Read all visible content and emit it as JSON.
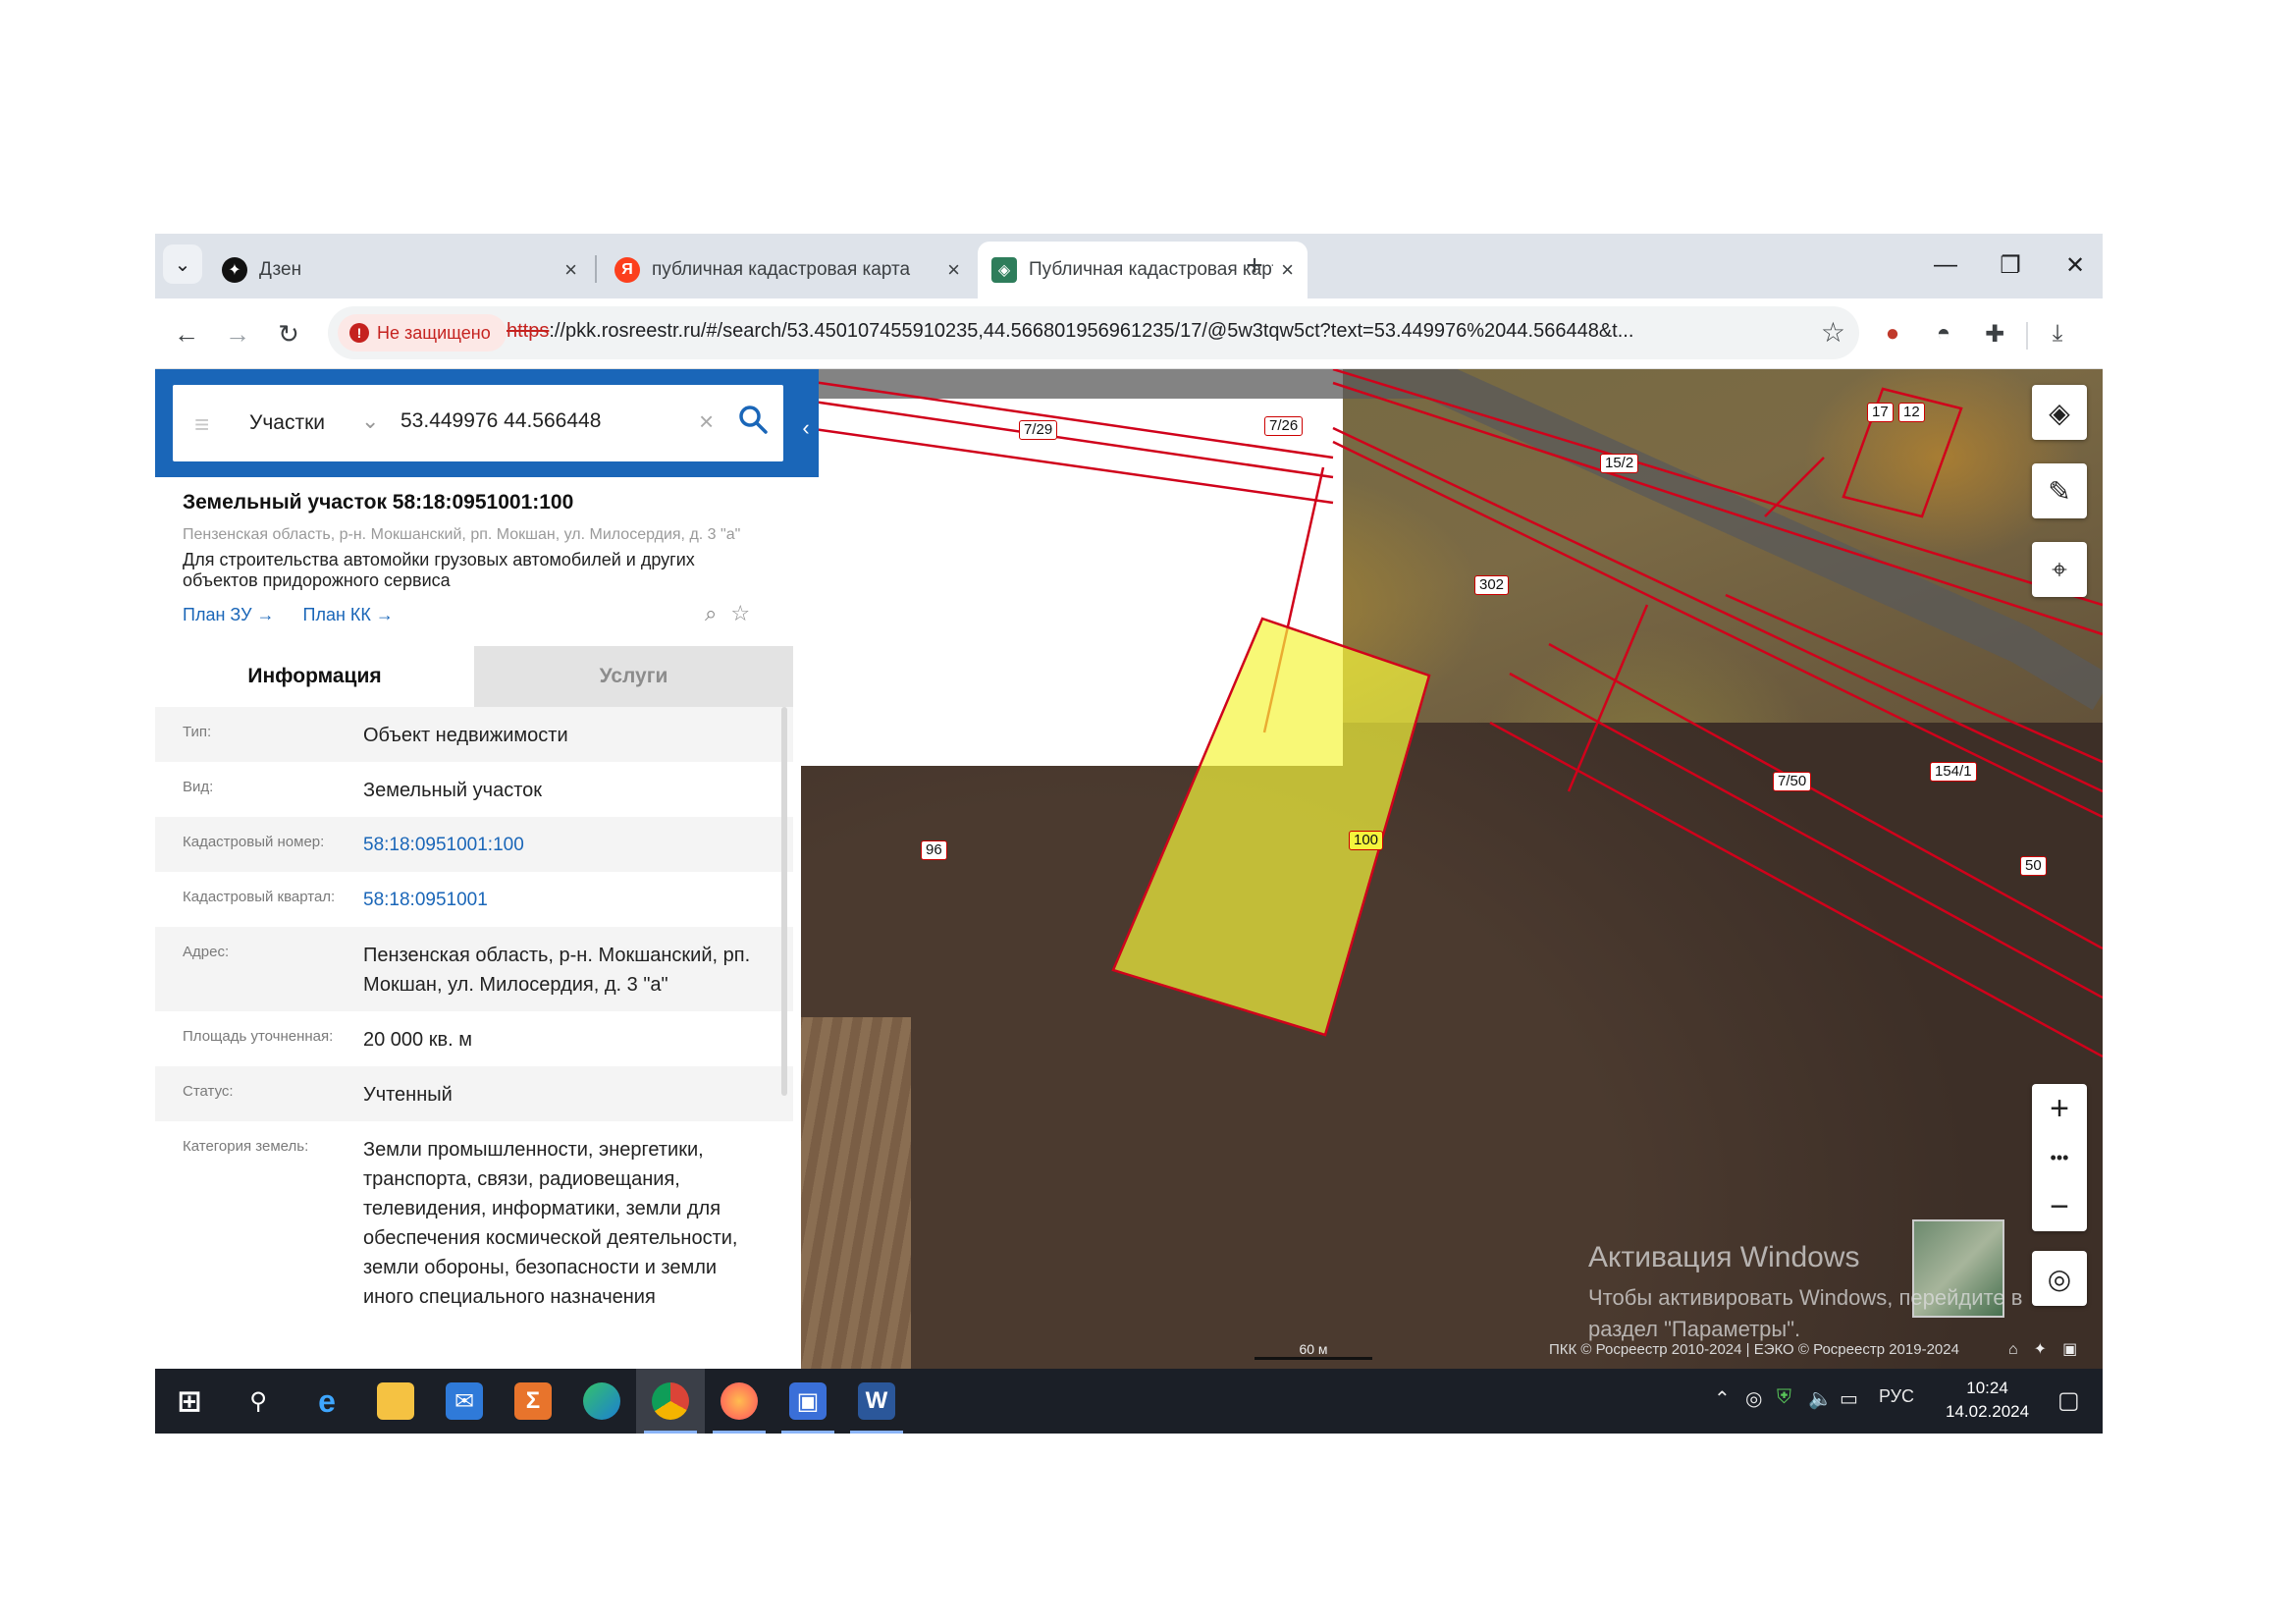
{
  "browser": {
    "tabs": [
      {
        "title": "Дзен",
        "icon": "dzen-icon",
        "active": false
      },
      {
        "title": "публичная кадастровая карта",
        "icon": "yandex-icon",
        "active": false
      },
      {
        "title": "Публичная кадастровая карта",
        "icon": "rosreestr-icon",
        "active": true
      }
    ],
    "new_tab_label": "+",
    "security_label": "Не защищено",
    "url_scheme": "https",
    "url_rest": "://pkk.rosreestr.ru/#/search/53.450107455910235,44.566801956961235/17/@5w3tqw5ct?text=53.449976%2044.566448&t..."
  },
  "search": {
    "category": "Участки",
    "query": "53.449976 44.566448"
  },
  "object": {
    "title": "Земельный участок 58:18:0951001:100",
    "address_short": "Пензенская область, р-н. Мокшанский, рп. Мокшан, ул. Милосердия, д. 3 \"а\"",
    "use": "Для строительства автомойки грузовых автомобилей и других объектов придорожного сервиса",
    "link_plan_zu": "План ЗУ →",
    "link_plan_kk": "План КК →"
  },
  "info_tabs": {
    "info": "Информация",
    "services": "Услуги"
  },
  "properties": [
    {
      "label": "Тип:",
      "value": "Объект недвижимости"
    },
    {
      "label": "Вид:",
      "value": "Земельный участок"
    },
    {
      "label": "Кадастровый номер:",
      "value": "58:18:0951001:100"
    },
    {
      "label": "Кадастровый квартал:",
      "value": "58:18:0951001"
    },
    {
      "label": "Адрес:",
      "value": "Пензенская область, р-н. Мокшанский, рп. Мокшан, ул. Милосердия, д. 3 \"а\""
    },
    {
      "label": "Площадь уточненная:",
      "value": "20 000 кв. м"
    },
    {
      "label": "Статус:",
      "value": "Учтенный"
    },
    {
      "label": "Категория земель:",
      "value": "Земли промышленности, энергетики, транспорта, связи, радиовещания, телевидения, информатики, земли для обеспечения космической деятельности, земли обороны, безопасности и земли иного специального назначения"
    }
  ],
  "map": {
    "parcel_labels": [
      "7/29",
      "7/26",
      "15/2",
      "17",
      "12",
      "302",
      "7/50",
      "154/1",
      "50",
      "96",
      "100"
    ],
    "scale_label": "60 м",
    "copyright": "ПКК © Росреестр 2010-2024 | ЕЭКО © Росреестр 2019-2024",
    "highlight_color": "#f5f53c",
    "boundary_color": "#d0021b",
    "zoom_dots": "•••"
  },
  "watermark": {
    "line1": "Активация Windows",
    "line2": "Чтобы активировать Windows, перейдите в",
    "line3": "раздел \"Параметры\"."
  },
  "taskbar": {
    "lang": "РУС",
    "time": "10:24",
    "date": "14.02.2024"
  }
}
